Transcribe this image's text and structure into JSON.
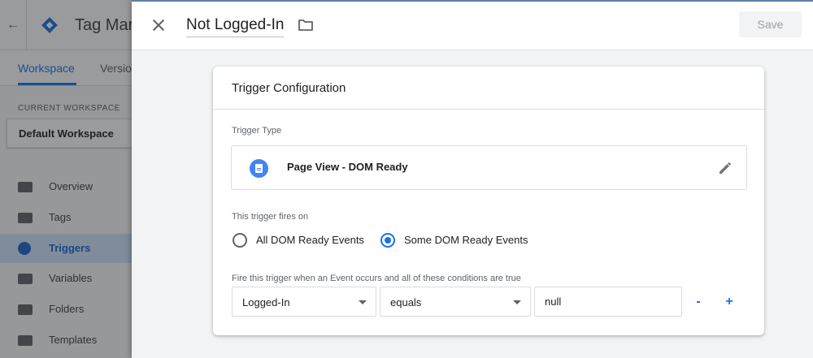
{
  "background_app": {
    "app_name": "Tag Mar",
    "tabs": [
      {
        "label": "Workspace",
        "active": true
      },
      {
        "label": "Versio",
        "active": false
      }
    ],
    "current_workspace_label": "CURRENT WORKSPACE",
    "current_workspace_name": "Default Workspace",
    "nav_items": [
      {
        "label": "Overview",
        "icon": "overview-icon",
        "active": false
      },
      {
        "label": "Tags",
        "icon": "tag-icon",
        "active": false
      },
      {
        "label": "Triggers",
        "icon": "trigger-icon",
        "active": true
      },
      {
        "label": "Variables",
        "icon": "variables-icon",
        "active": false
      },
      {
        "label": "Folders",
        "icon": "folder-icon",
        "active": false
      },
      {
        "label": "Templates",
        "icon": "templates-icon",
        "active": false
      }
    ]
  },
  "panel": {
    "trigger_name": "Not Logged-In",
    "save_label": "Save"
  },
  "card": {
    "title": "Trigger Configuration",
    "trigger_type_label": "Trigger Type",
    "trigger_type_value": "Page View - DOM Ready",
    "fires_on_label": "This trigger fires on",
    "fires_on_options": [
      {
        "label": "All DOM Ready Events",
        "checked": false
      },
      {
        "label": "Some DOM Ready Events",
        "checked": true
      }
    ],
    "conditions_label": "Fire this trigger when an Event occurs and all of these conditions are true",
    "condition": {
      "variable": "Logged-In",
      "operator": "equals",
      "value": "null",
      "remove_label": "-",
      "add_label": "+"
    }
  },
  "colors": {
    "accent": "#1a73e8",
    "type_icon": "#4285f4"
  }
}
